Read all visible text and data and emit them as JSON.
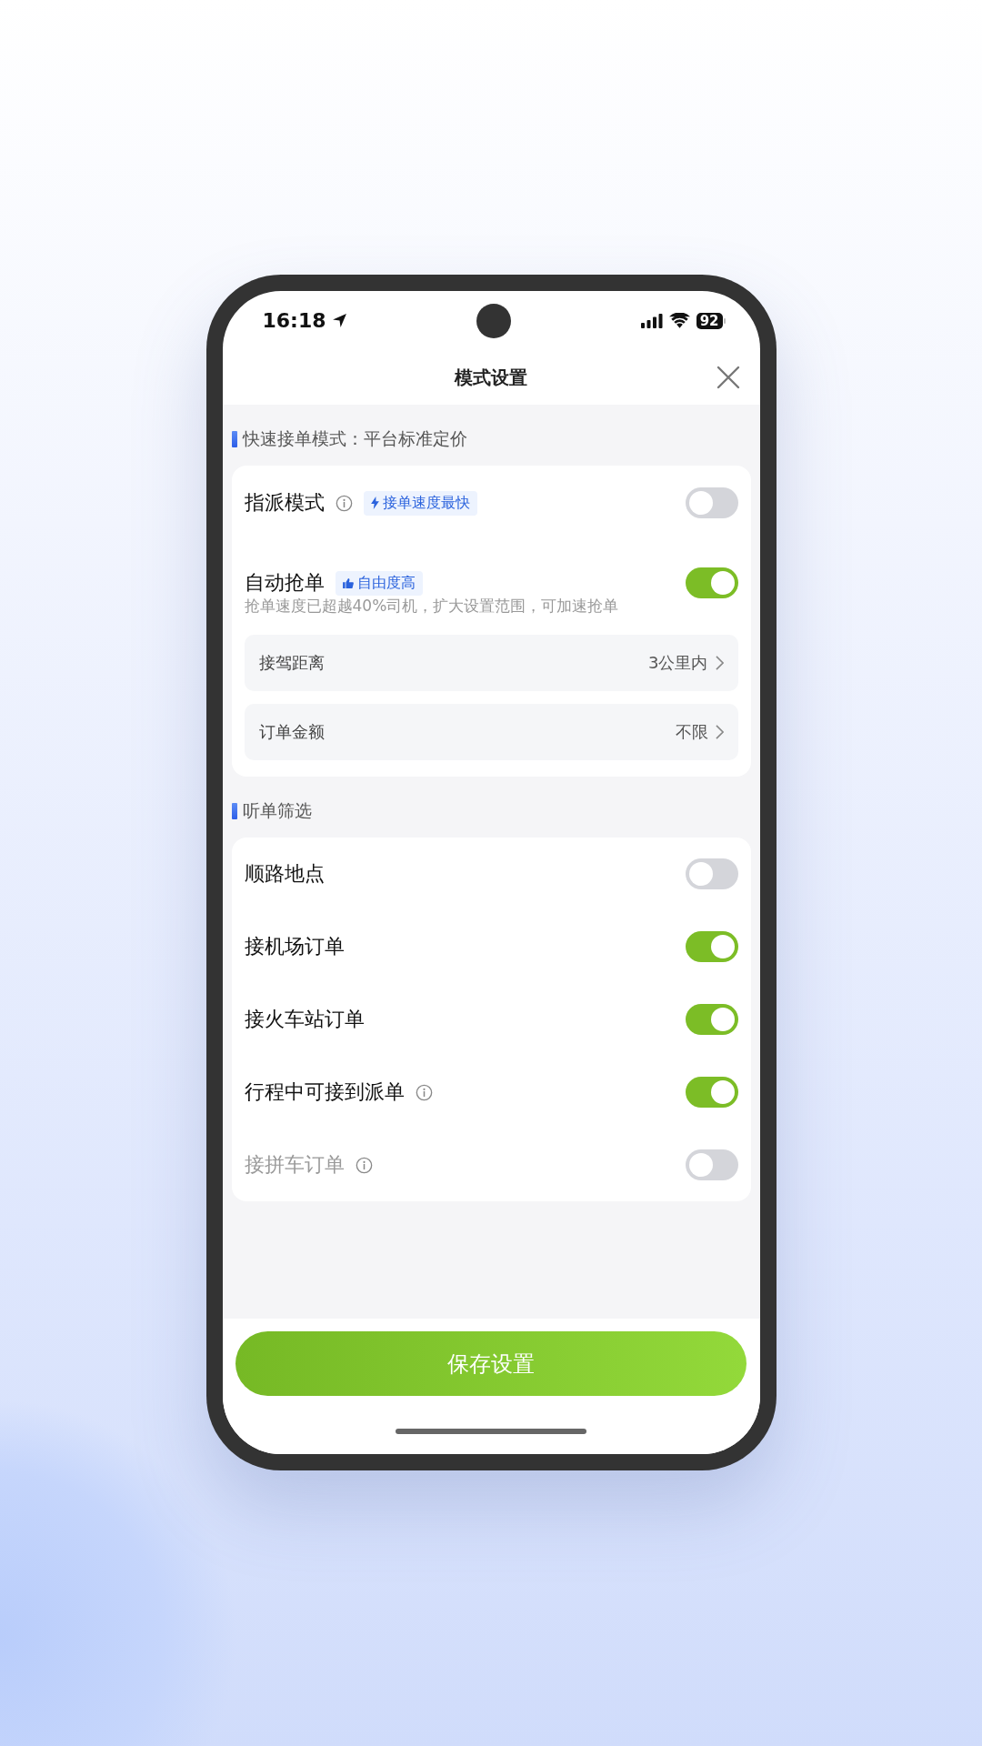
{
  "status_bar": {
    "time": "16:18",
    "battery": "92"
  },
  "header": {
    "title": "模式设置"
  },
  "mode_section": {
    "title": "快速接单模式：平台标准定价",
    "options": [
      {
        "label": "指派模式",
        "info": true,
        "tag": "接单速度最快",
        "on": false
      },
      {
        "label": "自动抢单",
        "info": false,
        "tag": "自由度高",
        "on": true,
        "note": "抢单速度已超越40%司机，扩大设置范围，可加速抢单"
      }
    ],
    "settings": [
      {
        "label": "接驾距离",
        "value": "3公里内"
      },
      {
        "label": "订单金额",
        "value": "不限"
      }
    ]
  },
  "filter_section": {
    "title": "听单筛选",
    "items": [
      {
        "label": "顺路地点",
        "info": false,
        "on": false,
        "disabled": false
      },
      {
        "label": "接机场订单",
        "info": false,
        "on": true,
        "disabled": false
      },
      {
        "label": "接火车站订单",
        "info": false,
        "on": true,
        "disabled": false
      },
      {
        "label": "行程中可接到派单",
        "info": true,
        "on": true,
        "disabled": false
      },
      {
        "label": "接拼车订单",
        "info": true,
        "on": false,
        "disabled": true
      }
    ]
  },
  "save_button": "保存设置"
}
